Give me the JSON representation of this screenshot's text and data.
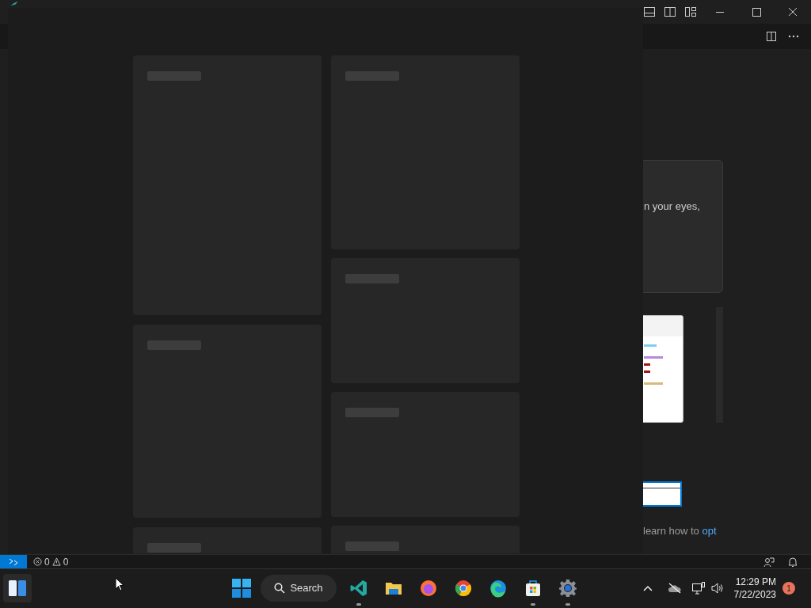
{
  "editor": {
    "card_text": "n your eyes,",
    "footer_text": "learn how to",
    "footer_link": "opt"
  },
  "status_bar": {
    "errors": "0",
    "warnings": "0"
  },
  "taskbar": {
    "search": {
      "label": "Search"
    },
    "apps": [
      {
        "kind": "vscode",
        "running": true
      },
      {
        "kind": "explorer",
        "running": false
      },
      {
        "kind": "firefox",
        "running": false
      },
      {
        "kind": "chrome",
        "running": false
      },
      {
        "kind": "edge",
        "running": false
      },
      {
        "kind": "store",
        "running": true
      },
      {
        "kind": "settings",
        "running": true
      }
    ],
    "clock": {
      "time": "12:29 PM",
      "date": "7/22/2023"
    },
    "notification_count": "1"
  }
}
